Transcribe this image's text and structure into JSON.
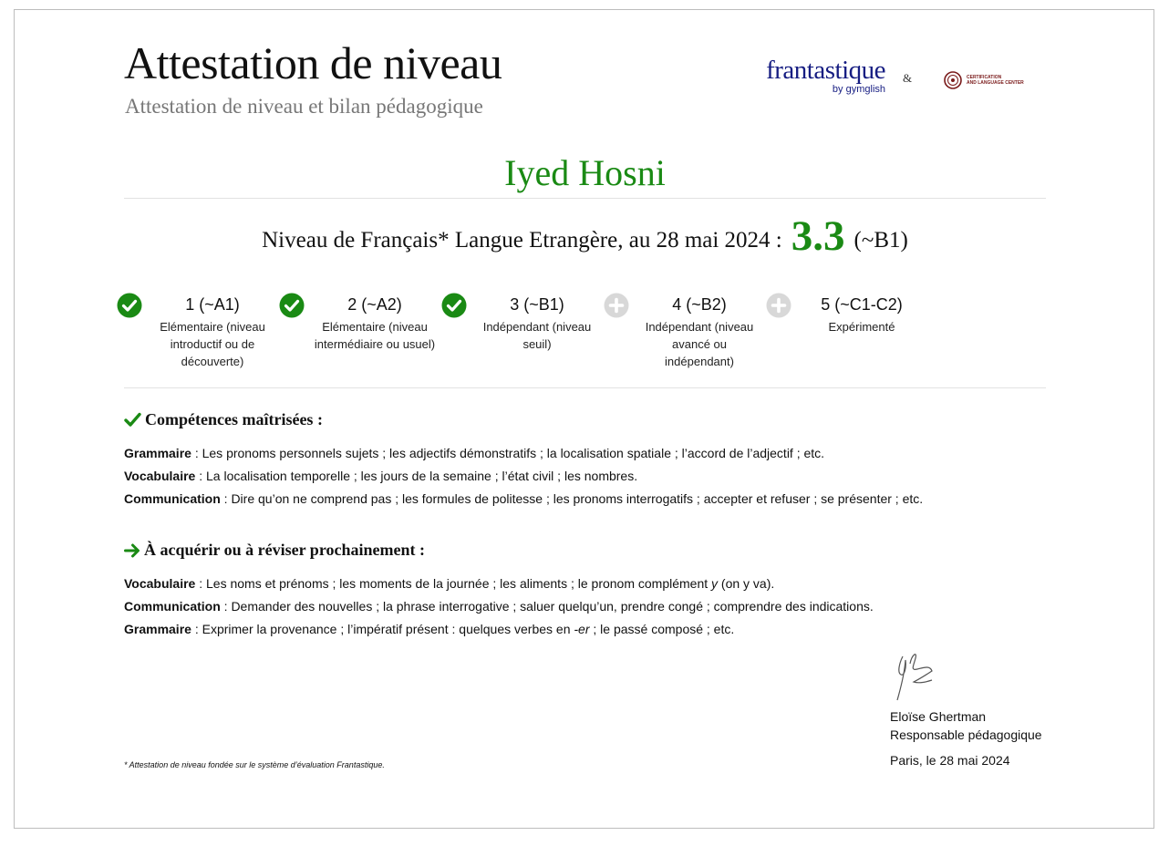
{
  "header": {
    "title": "Attestation de niveau",
    "subtitle": "Attestation de niveau et bilan pédagogique",
    "brand": "frantastique",
    "brand_by": "by gymglish",
    "ampersand": "&",
    "partner_line1": "CERTIFICATION",
    "partner_line2": "AND LANGUAGE CENTER"
  },
  "student_name": "Iyed Hosni",
  "level": {
    "label": "Niveau de Français* Langue Etrangère, au 28 mai 2024 :",
    "score": "3.3",
    "cefr": "(~B1)"
  },
  "steps": [
    {
      "level": "1 (~A1)",
      "description": "Elémentaire (niveau introductif ou de découverte)",
      "status": "achieved"
    },
    {
      "level": "2 (~A2)",
      "description": "Elémentaire (niveau intermédiaire ou usuel)",
      "status": "achieved"
    },
    {
      "level": "3 (~B1)",
      "description": "Indépendant (niveau seuil)",
      "status": "achieved"
    },
    {
      "level": "4 (~B2)",
      "description": "Indépendant (niveau avancé ou indépendant)",
      "status": "pending"
    },
    {
      "level": "5 (~C1-C2)",
      "description": "Expérimenté",
      "status": "pending"
    }
  ],
  "mastered": {
    "heading": "Compétences maîtrisées :",
    "items": [
      {
        "label": "Grammaire",
        "text": " : Les pronoms personnels sujets ; les adjectifs démonstratifs ; la localisation spatiale ; l’accord de l’adjectif ; etc."
      },
      {
        "label": "Vocabulaire",
        "text": " : La localisation temporelle ; les jours de la semaine ; l’état civil ; les nombres."
      },
      {
        "label": "Communication",
        "text": " : Dire qu’on ne comprend pas ; les formules de politesse ; les pronoms interrogatifs ; accepter et refuser ; se présenter ; etc."
      }
    ]
  },
  "to_learn": {
    "heading": "À acquérir ou à réviser prochainement :",
    "vocab_label": "Vocabulaire",
    "vocab_text_a": " : Les noms et prénoms ; les moments de la journée ; les aliments ; le pronom complément ",
    "vocab_text_em": "y",
    "vocab_text_b": " (on y va).",
    "comm_label": "Communication",
    "comm_text": " : Demander des nouvelles ; la phrase interrogative ; saluer quelqu’un, prendre congé ; comprendre des indications.",
    "gram_label": "Grammaire",
    "gram_text_a": " : Exprimer la provenance ; l’impératif présent : quelques verbes en ",
    "gram_text_em": "-er",
    "gram_text_b": " ; le passé composé ; etc."
  },
  "signature": {
    "name": "Eloïse Ghertman",
    "role": "Responsable pédagogique",
    "place_date": "Paris, le 28 mai 2024"
  },
  "footnote": "* Attestation de niveau fondée sur le système d’évaluation Frantastique.",
  "colors": {
    "accent_green": "#1a8a14",
    "brand_blue": "#161d82",
    "pending_gray": "#d8d8d8"
  }
}
